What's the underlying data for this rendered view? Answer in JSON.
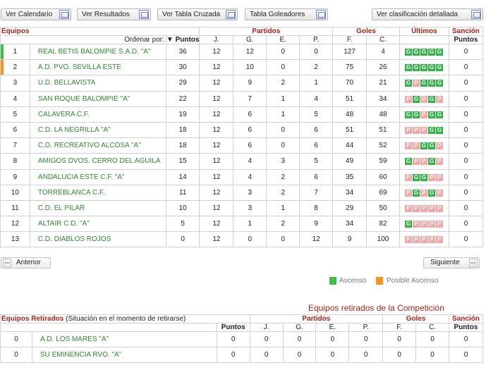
{
  "toolbar": {
    "calendario": "Ver Calendario",
    "resultados": "Ver Resultados",
    "tabla_cruzada": "Ver Tabla Cruzada",
    "goleadores": "Tabla Goleadores",
    "clasificacion_detallada": "Ver clasificación detallada"
  },
  "table": {
    "groups": {
      "equipos": "Equipos",
      "partidos": "Partidos",
      "goles": "Goles",
      "ultimos": "Últimos",
      "sancion": "Sanción"
    },
    "sub": {
      "ordenar": "Ordenar por:",
      "puntos": "Puntos",
      "j": "J.",
      "g": "G.",
      "e": "E.",
      "p": "P.",
      "f": "F.",
      "c": "C.",
      "sancion_puntos": "Puntos"
    },
    "rows": [
      {
        "pos": "1",
        "team": "REAL BETIS BALOMPIE S.A.D. \"A\"",
        "pts": "36",
        "j": "12",
        "g": "12",
        "e": "0",
        "p": "0",
        "f": "127",
        "c": "4",
        "last": "GGGGG",
        "sancion": "0",
        "mark": "#3fbf4a"
      },
      {
        "pos": "2",
        "team": "A.D. PVO. SEVILLA ESTE",
        "pts": "30",
        "j": "12",
        "g": "10",
        "e": "0",
        "p": "2",
        "f": "75",
        "c": "26",
        "last": "GGGGG",
        "sancion": "0",
        "mark": "#f7941d"
      },
      {
        "pos": "3",
        "team": "U.D. BELLAVISTA",
        "pts": "29",
        "j": "12",
        "g": "9",
        "e": "2",
        "p": "1",
        "f": "70",
        "c": "21",
        "last": "GPGGG",
        "sancion": "0",
        "mark": ""
      },
      {
        "pos": "4",
        "team": "SAN ROQUE BALOMPIE \"A\"",
        "pts": "22",
        "j": "12",
        "g": "7",
        "e": "1",
        "p": "4",
        "f": "51",
        "c": "34",
        "last": "PGPGP",
        "sancion": "0",
        "mark": ""
      },
      {
        "pos": "5",
        "team": "CALAVERA C.F.",
        "pts": "19",
        "j": "12",
        "g": "6",
        "e": "1",
        "p": "5",
        "f": "48",
        "c": "48",
        "last": "GGPGG",
        "sancion": "0",
        "mark": ""
      },
      {
        "pos": "6",
        "team": "C.D. LA NEGRILLA \"A\"",
        "pts": "18",
        "j": "12",
        "g": "6",
        "e": "0",
        "p": "6",
        "f": "51",
        "c": "51",
        "last": "PPPGG",
        "sancion": "0",
        "mark": ""
      },
      {
        "pos": "7",
        "team": "C.D. RECREATIVO ALCOSA \"A\"",
        "pts": "18",
        "j": "12",
        "g": "6",
        "e": "0",
        "p": "6",
        "f": "44",
        "c": "52",
        "last": "PPGGP",
        "sancion": "0",
        "mark": ""
      },
      {
        "pos": "8",
        "team": "AMIGOS DVOS. CERRO DEL AGUILA",
        "pts": "15",
        "j": "12",
        "g": "4",
        "e": "3",
        "p": "5",
        "f": "49",
        "c": "59",
        "last": "GPPGP",
        "sancion": "0",
        "mark": ""
      },
      {
        "pos": "9",
        "team": "ANDALUCIA ESTE C.F. \"A\"",
        "pts": "14",
        "j": "12",
        "g": "4",
        "e": "2",
        "p": "6",
        "f": "35",
        "c": "60",
        "last": "PGGPP",
        "sancion": "0",
        "mark": ""
      },
      {
        "pos": "10",
        "team": "TORREBLANCA C.F.",
        "pts": "11",
        "j": "12",
        "g": "3",
        "e": "2",
        "p": "7",
        "f": "34",
        "c": "69",
        "last": "PGPGP",
        "sancion": "0",
        "mark": ""
      },
      {
        "pos": "11",
        "team": "C.D. EL PILAR",
        "pts": "10",
        "j": "12",
        "g": "3",
        "e": "1",
        "p": "8",
        "f": "29",
        "c": "50",
        "last": "PPPPP",
        "sancion": "0",
        "mark": ""
      },
      {
        "pos": "12",
        "team": "ALTAIR C.D. \"A\"",
        "pts": "5",
        "j": "12",
        "g": "1",
        "e": "2",
        "p": "9",
        "f": "34",
        "c": "82",
        "last": "GPPPP",
        "sancion": "0",
        "mark": ""
      },
      {
        "pos": "13",
        "team": "C.D. DIABLOS ROJOS",
        "pts": "0",
        "j": "12",
        "g": "0",
        "e": "0",
        "p": "12",
        "f": "9",
        "c": "100",
        "last": "PPPPP",
        "sancion": "0",
        "mark": ""
      }
    ]
  },
  "nav": {
    "anterior": "Anterior",
    "siguiente": "Siguiente"
  },
  "legend": [
    {
      "label": "Ascenso",
      "color": "#3fbf4a"
    },
    {
      "label": "Posible Ascenso",
      "color": "#f7941d"
    }
  ],
  "retirados": {
    "title": "Equipos retirados de la Competición",
    "group_label": "Equipos Retirados",
    "group_note": "(Situación en el momento de retirarse)",
    "groups": {
      "partidos": "Partidos",
      "goles": "Goles",
      "sancion": "Sanción"
    },
    "sub": {
      "puntos": "Puntos",
      "j": "J.",
      "g": "G.",
      "e": "E.",
      "p": "P.",
      "f": "F.",
      "c": "C.",
      "sancion_puntos": "Puntos"
    },
    "rows": [
      {
        "pos": "0",
        "team": "A.D. LOS MARES \"A\"",
        "pts": "0",
        "j": "0",
        "g": "0",
        "e": "0",
        "p": "0",
        "f": "0",
        "c": "0",
        "sancion": "0"
      },
      {
        "pos": "0",
        "team": "SU EMINENCIA RVO. \"A\"",
        "pts": "0",
        "j": "0",
        "g": "0",
        "e": "0",
        "p": "0",
        "f": "0",
        "c": "0",
        "sancion": "0"
      }
    ]
  }
}
